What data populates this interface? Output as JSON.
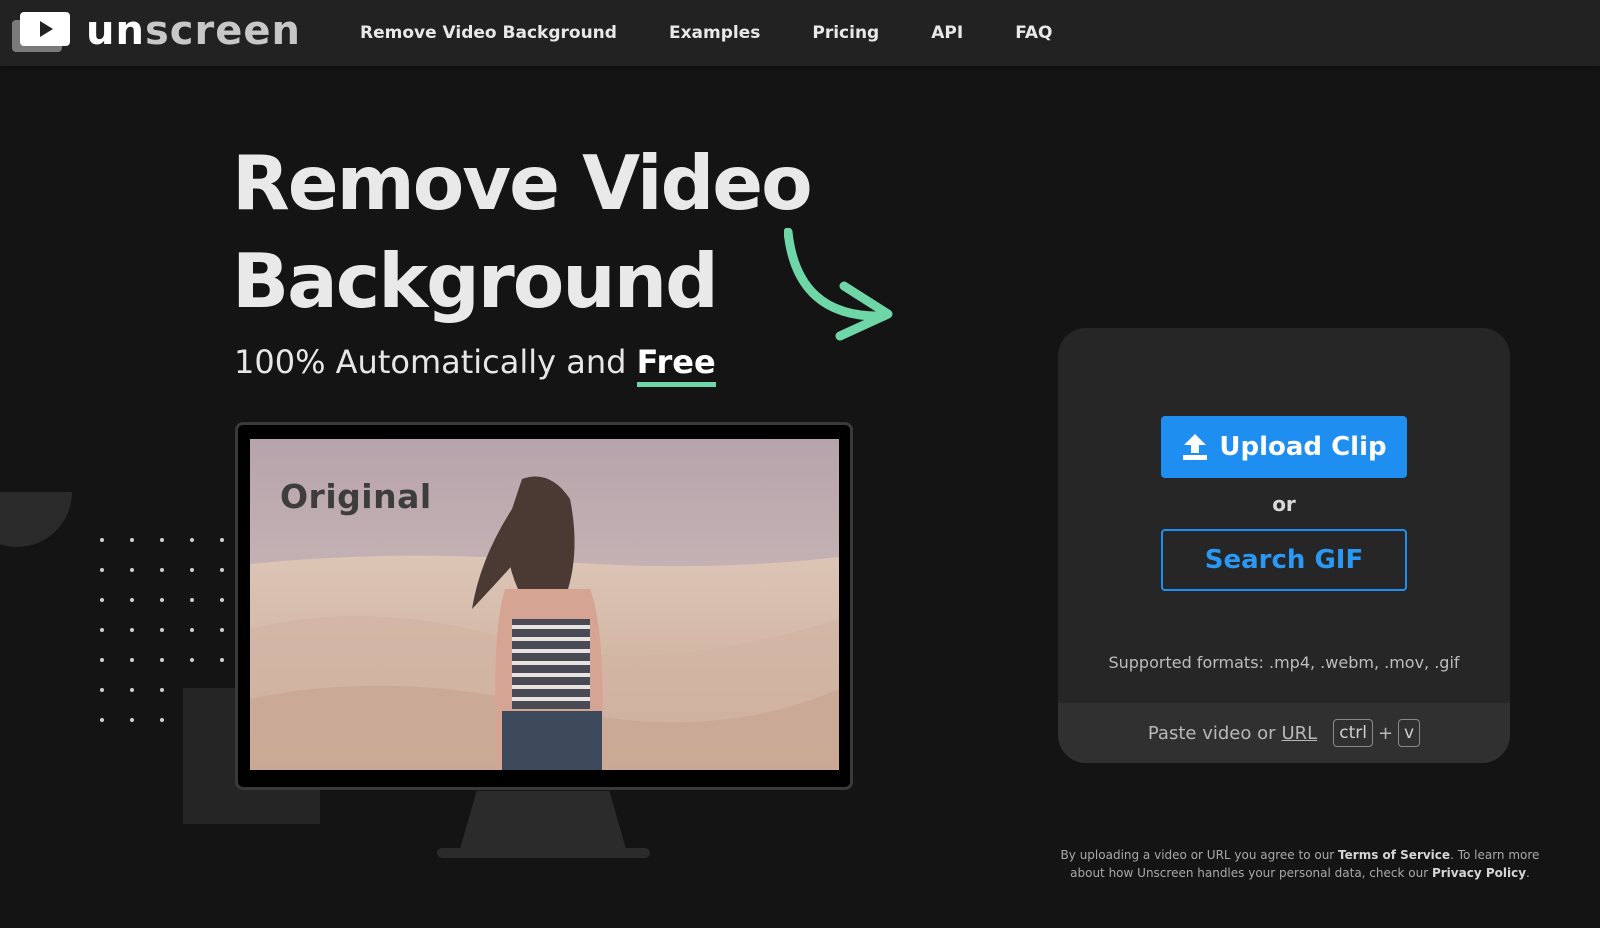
{
  "nav": {
    "brand_first": "un",
    "brand_second": "screen",
    "links": [
      "Remove Video Background",
      "Examples",
      "Pricing",
      "API",
      "FAQ"
    ]
  },
  "hero": {
    "title_line1": "Remove Video",
    "title_line2": "Background",
    "subtitle_prefix": "100% Automatically and ",
    "subtitle_highlight": "Free",
    "accent_color": "#6fd6a8"
  },
  "preview": {
    "label": "Original"
  },
  "upload": {
    "upload_label": "Upload Clip",
    "or_label": "or",
    "search_label": "Search GIF",
    "formats": "Supported formats: .mp4, .webm, .mov, .gif",
    "paste_prefix": "Paste video or",
    "paste_link": "URL",
    "key_ctrl": "ctrl",
    "key_plus": "+",
    "key_v": "v",
    "primary_color": "#1f8ef1"
  },
  "legal": {
    "part1": "By uploading a video or URL you agree to our ",
    "terms": "Terms of Service",
    "part2": ". To learn more about how Unscreen handles your personal data, check our ",
    "privacy": "Privacy Policy",
    "part3": "."
  },
  "icons": [
    "play-icon",
    "upload-icon",
    "arrow-icon"
  ]
}
